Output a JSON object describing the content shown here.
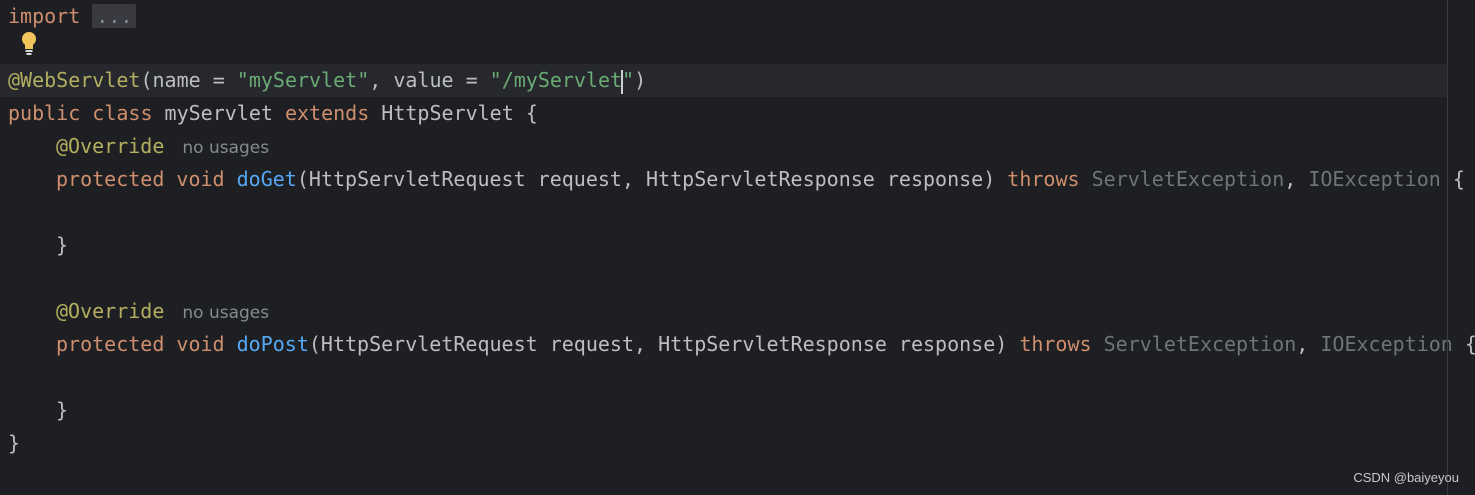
{
  "code": {
    "import_kw": "import",
    "import_fold": "...",
    "annotation_name": "@WebServlet",
    "ann_open": "(name = ",
    "ann_name_value": "\"myServlet\"",
    "ann_mid": ", value = ",
    "ann_value_before_caret": "\"/myServlet",
    "ann_value_after_caret": "\"",
    "ann_close": ")",
    "kw_public": "public",
    "kw_class": "class",
    "class_name": " myServlet ",
    "kw_extends": "extends",
    "superclass": " HttpServlet {",
    "override": "@Override",
    "no_usages": "no usages",
    "kw_protected": "protected",
    "kw_void": "void",
    "method_get": "doGet",
    "method_post": "doPost",
    "params": "(HttpServletRequest request, HttpServletResponse response) ",
    "kw_throws": "throws",
    "ex1": "ServletException",
    "comma": ", ",
    "ex2": "IOException",
    "open_brace": " {",
    "close_brace": "}"
  },
  "colors": {
    "keyword": "#cf8e6d",
    "annotation": "#b3ae60",
    "string": "#6aab73",
    "method": "#56a8f5",
    "unused": "#6f737a"
  },
  "icons": {
    "intention": "lightbulb-icon"
  },
  "watermark": "CSDN @baiyeyou"
}
